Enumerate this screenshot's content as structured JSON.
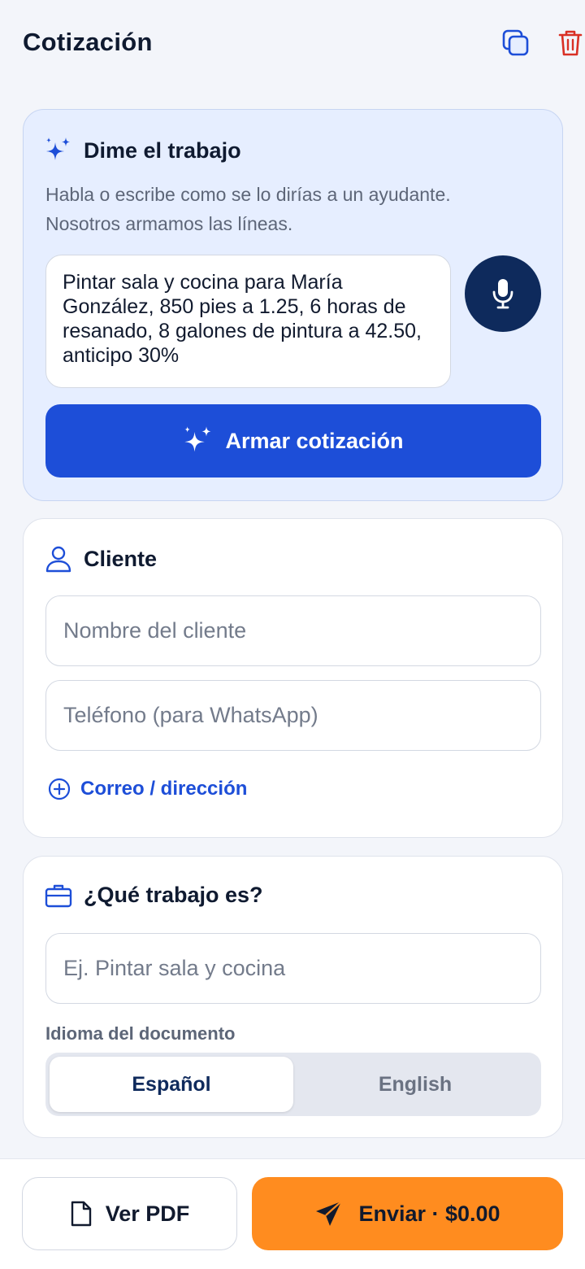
{
  "header": {
    "title": "Cotización",
    "copy_icon": "copy-icon",
    "trash_icon": "trash-icon"
  },
  "ai_card": {
    "title": "Dime el trabajo",
    "subtitle": "Habla o escribe como se lo dirías a un ayudante. Nosotros armamos las líneas.",
    "prompt_text": "Pintar sala y cocina para María González, 850 pies a 1.25, 6 horas de resanado, 8 galones de pintura a 42.50, anticipo 30%",
    "mic_icon": "microphone-icon",
    "build_button": "Armar cotización"
  },
  "client_card": {
    "title": "Cliente",
    "name_placeholder": "Nombre del cliente",
    "phone_placeholder": "Teléfono (para WhatsApp)",
    "add_link": "Correo / dirección"
  },
  "job_card": {
    "title": "¿Qué trabajo es?",
    "job_placeholder": "Ej. Pintar sala y cocina",
    "language_label": "Idioma del documento",
    "language_options": [
      "Español",
      "English"
    ],
    "selected_language": "Español"
  },
  "footer": {
    "pdf_button": "Ver PDF",
    "send_button": "Enviar · $0.00"
  },
  "colors": {
    "primary": "#1d4ed8",
    "navy": "#0e2a5c",
    "send": "#ff8c1f",
    "danger": "#d93025"
  }
}
